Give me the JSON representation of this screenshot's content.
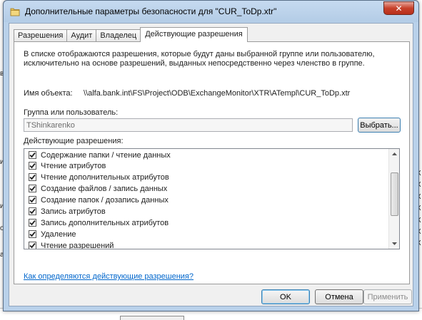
{
  "dialog": {
    "title": "Дополнительные параметры безопасности для \"CUR_ToDp.xtr\"",
    "tabs": [
      {
        "label": "Разрешения"
      },
      {
        "label": "Аудит"
      },
      {
        "label": "Владелец"
      },
      {
        "label": "Действующие разрешения",
        "active": true
      }
    ],
    "description": "В списке отображаются разрешения, которые будут даны выбранной группе или пользователю, исключительно на основе разрешений, выданных непосредственно через членство в группе.",
    "object_label": "Имя объекта:",
    "object_value": "\\\\alfa.bank.int\\FS\\Project\\ODB\\ExchangeMonitor\\XTR\\ATempl\\CUR_ToDp.xtr",
    "group_label": "Группа или пользователь:",
    "group_value": "TShinkarenko",
    "select_button": "Выбрать...",
    "effective_label": "Действующие разрешения:",
    "permissions": [
      {
        "label": "Содержание папки / чтение данных",
        "checked": true
      },
      {
        "label": "Чтение атрибутов",
        "checked": true
      },
      {
        "label": "Чтение дополнительных атрибутов",
        "checked": true
      },
      {
        "label": "Создание файлов / запись данных",
        "checked": true
      },
      {
        "label": "Создание папок / дозапись данных",
        "checked": true
      },
      {
        "label": "Запись атрибутов",
        "checked": true
      },
      {
        "label": "Запись дополнительных атрибутов",
        "checked": true
      },
      {
        "label": "Удаление",
        "checked": true
      },
      {
        "label": "Чтение разрешений",
        "checked": true
      }
    ],
    "help_link": "Как определяются действующие разрешения?",
    "buttons": {
      "ok": "OK",
      "cancel": "Отмена",
      "apply": "Применить"
    }
  },
  "background": {
    "right_fragments": [
      "X",
      "X",
      "X",
      "X",
      "X",
      "X",
      "X"
    ]
  },
  "colors": {
    "frame": "#b9d1ea",
    "link": "#0066cc",
    "close_button": "#c7412b"
  },
  "icons": {
    "title": "folder-icon",
    "close": "close-icon",
    "checkbox": "checkmark-icon",
    "scroll_up": "scroll-up-arrow-icon",
    "scroll_down": "scroll-down-arrow-icon"
  }
}
